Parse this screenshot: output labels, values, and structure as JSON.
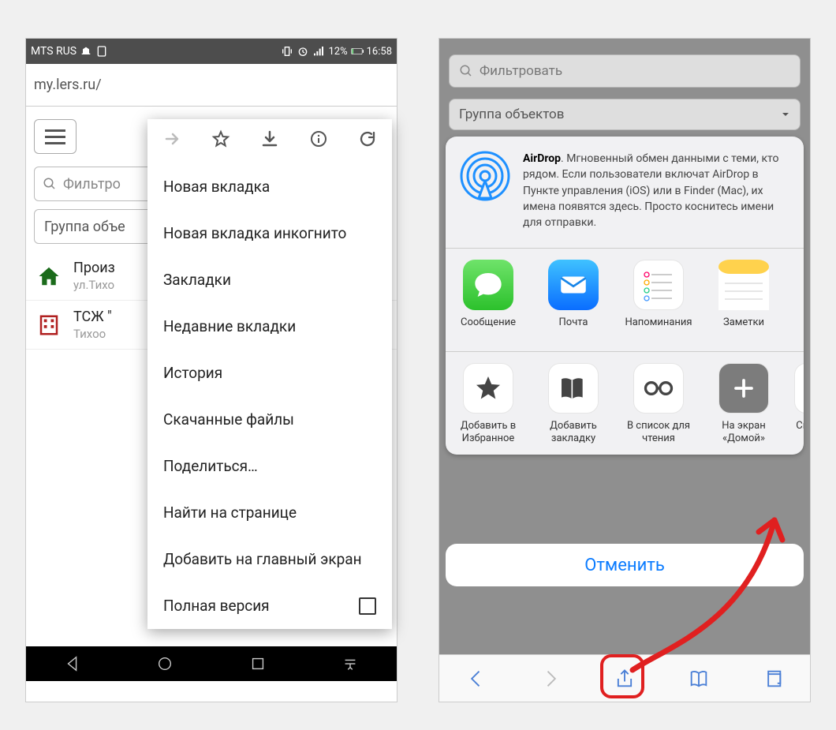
{
  "android": {
    "status": {
      "carrier": "MTS RUS",
      "battery": "12%",
      "time": "16:58"
    },
    "url": "my.lers.ru/",
    "filter_placeholder": "Фильтро",
    "group_label": "Группа объе",
    "items": [
      {
        "title": "Произ",
        "sub": "ул.Тихо"
      },
      {
        "title": "ТСЖ \"",
        "sub": "Тихоо"
      }
    ],
    "menu": {
      "new_tab": "Новая вкладка",
      "incognito": "Новая вкладка инкогнито",
      "bookmarks": "Закладки",
      "recent": "Недавние вкладки",
      "history": "История",
      "downloads": "Скачанные файлы",
      "share": "Поделиться…",
      "find": "Найти на странице",
      "homescreen": "Добавить на главный экран",
      "desktop": "Полная версия"
    }
  },
  "ios": {
    "filter_placeholder": "Фильтровать",
    "group_label": "Группа объектов",
    "airdrop_title": "AirDrop",
    "airdrop_text": ". Мгновенный обмен данными с теми, кто рядом. Если пользователи включат AirDrop в Пункте управления (iOS) или в Finder (Mac), их имена появятся здесь. Просто коснитесь имени для отправки.",
    "apps": [
      {
        "label": "Сообщение"
      },
      {
        "label": "Почта"
      },
      {
        "label": "Напоминания"
      },
      {
        "label": "Заметки"
      }
    ],
    "actions": [
      {
        "label": "Добавить в Избранное"
      },
      {
        "label": "Добавить закладку"
      },
      {
        "label": "В список для чтения"
      },
      {
        "label": "На экран «Домой»"
      },
      {
        "label": "Ск"
      }
    ],
    "cancel": "Отменить"
  }
}
